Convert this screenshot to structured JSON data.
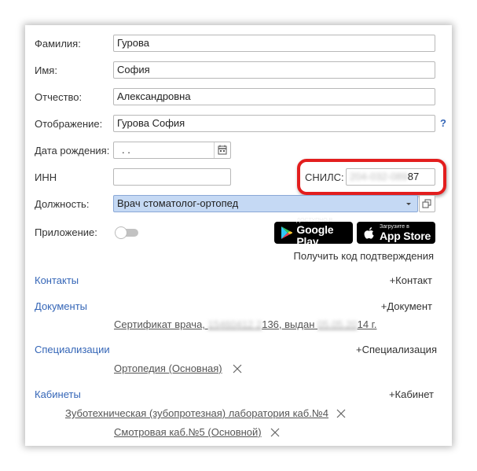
{
  "form": {
    "surname_label": "Фамилия:",
    "surname_value": "Гурова",
    "name_label": "Имя:",
    "name_value": "София",
    "patronymic_label": "Отчество:",
    "patronymic_value": "Александровна",
    "display_label": "Отображение:",
    "display_value": "Гурова София",
    "help_icon": "?",
    "birthdate_label": "Дата рождения:",
    "birthdate_value": " .  .",
    "inn_label": "ИНН",
    "inn_value": "",
    "snils_label": "СНИЛС:",
    "snils_value_hidden": "204-032-089",
    "snils_value_tail": "87",
    "position_label": "Должность:",
    "position_value": "Врач стоматолог-ортопед",
    "app_label": "Приложение:",
    "google_play_small": "ДОСТУПНО В",
    "google_play_big": "Google Play",
    "app_store_small": "Загрузите в",
    "app_store_big": "App Store",
    "get_code_label": "Получить код подтверждения"
  },
  "sections": {
    "contacts_label": "Контакты",
    "contacts_add": "+Контакт",
    "documents_label": "Документы",
    "documents_add": "+Документ",
    "doc_item_prefix": "Сертификат врача, ",
    "doc_item_hidden1": "15460412 2",
    "doc_item_mid": "136, выдан ",
    "doc_item_hidden2": "05.05.20",
    "doc_item_suffix": "14 г.",
    "specializations_label": "Специализации",
    "specializations_add": "+Специализация",
    "spec_item": "Ортопедия (Основная)",
    "cabinets_label": "Кабинеты",
    "cabinets_add": "+Кабинет",
    "cabinet_item_1": "Зуботехническая (зубопротезная) лаборатория каб.№4",
    "cabinet_item_2": "Смотровая каб.№5 (Основной)"
  },
  "colors": {
    "link": "#3566b7",
    "highlight_ring": "#e31e1e",
    "position_field_bg": "#c5d9f4"
  }
}
